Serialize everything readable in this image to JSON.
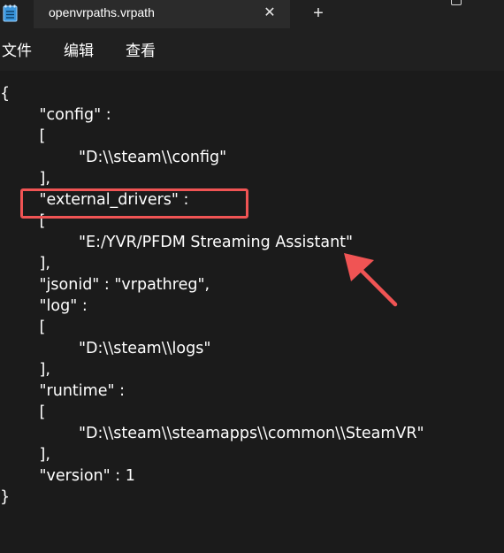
{
  "window": {
    "tab_title": "openvrpaths.vrpath",
    "close_glyph": "✕",
    "new_tab_glyph": "+"
  },
  "menu": {
    "items": [
      "文件",
      "编辑",
      "查看"
    ]
  },
  "editor": {
    "lines": [
      "{",
      "        \"config\" :",
      "        [",
      "                \"D:\\\\steam\\\\config\"",
      "        ],",
      "        \"external_drivers\" :",
      "        [",
      "                \"E:/YVR/PFDM Streaming Assistant\"",
      "        ],",
      "        \"jsonid\" : \"vrpathreg\",",
      "        \"log\" :",
      "        [",
      "                \"D:\\\\steam\\\\logs\"",
      "        ],",
      "        \"runtime\" :",
      "        [",
      "                \"D:\\\\steam\\\\steamapps\\\\common\\\\SteamVR\"",
      "        ],",
      "        \"version\" : 1",
      "}"
    ]
  },
  "annotation": {
    "highlight_color": "#f05454",
    "highlighted_key": "external_drivers"
  }
}
